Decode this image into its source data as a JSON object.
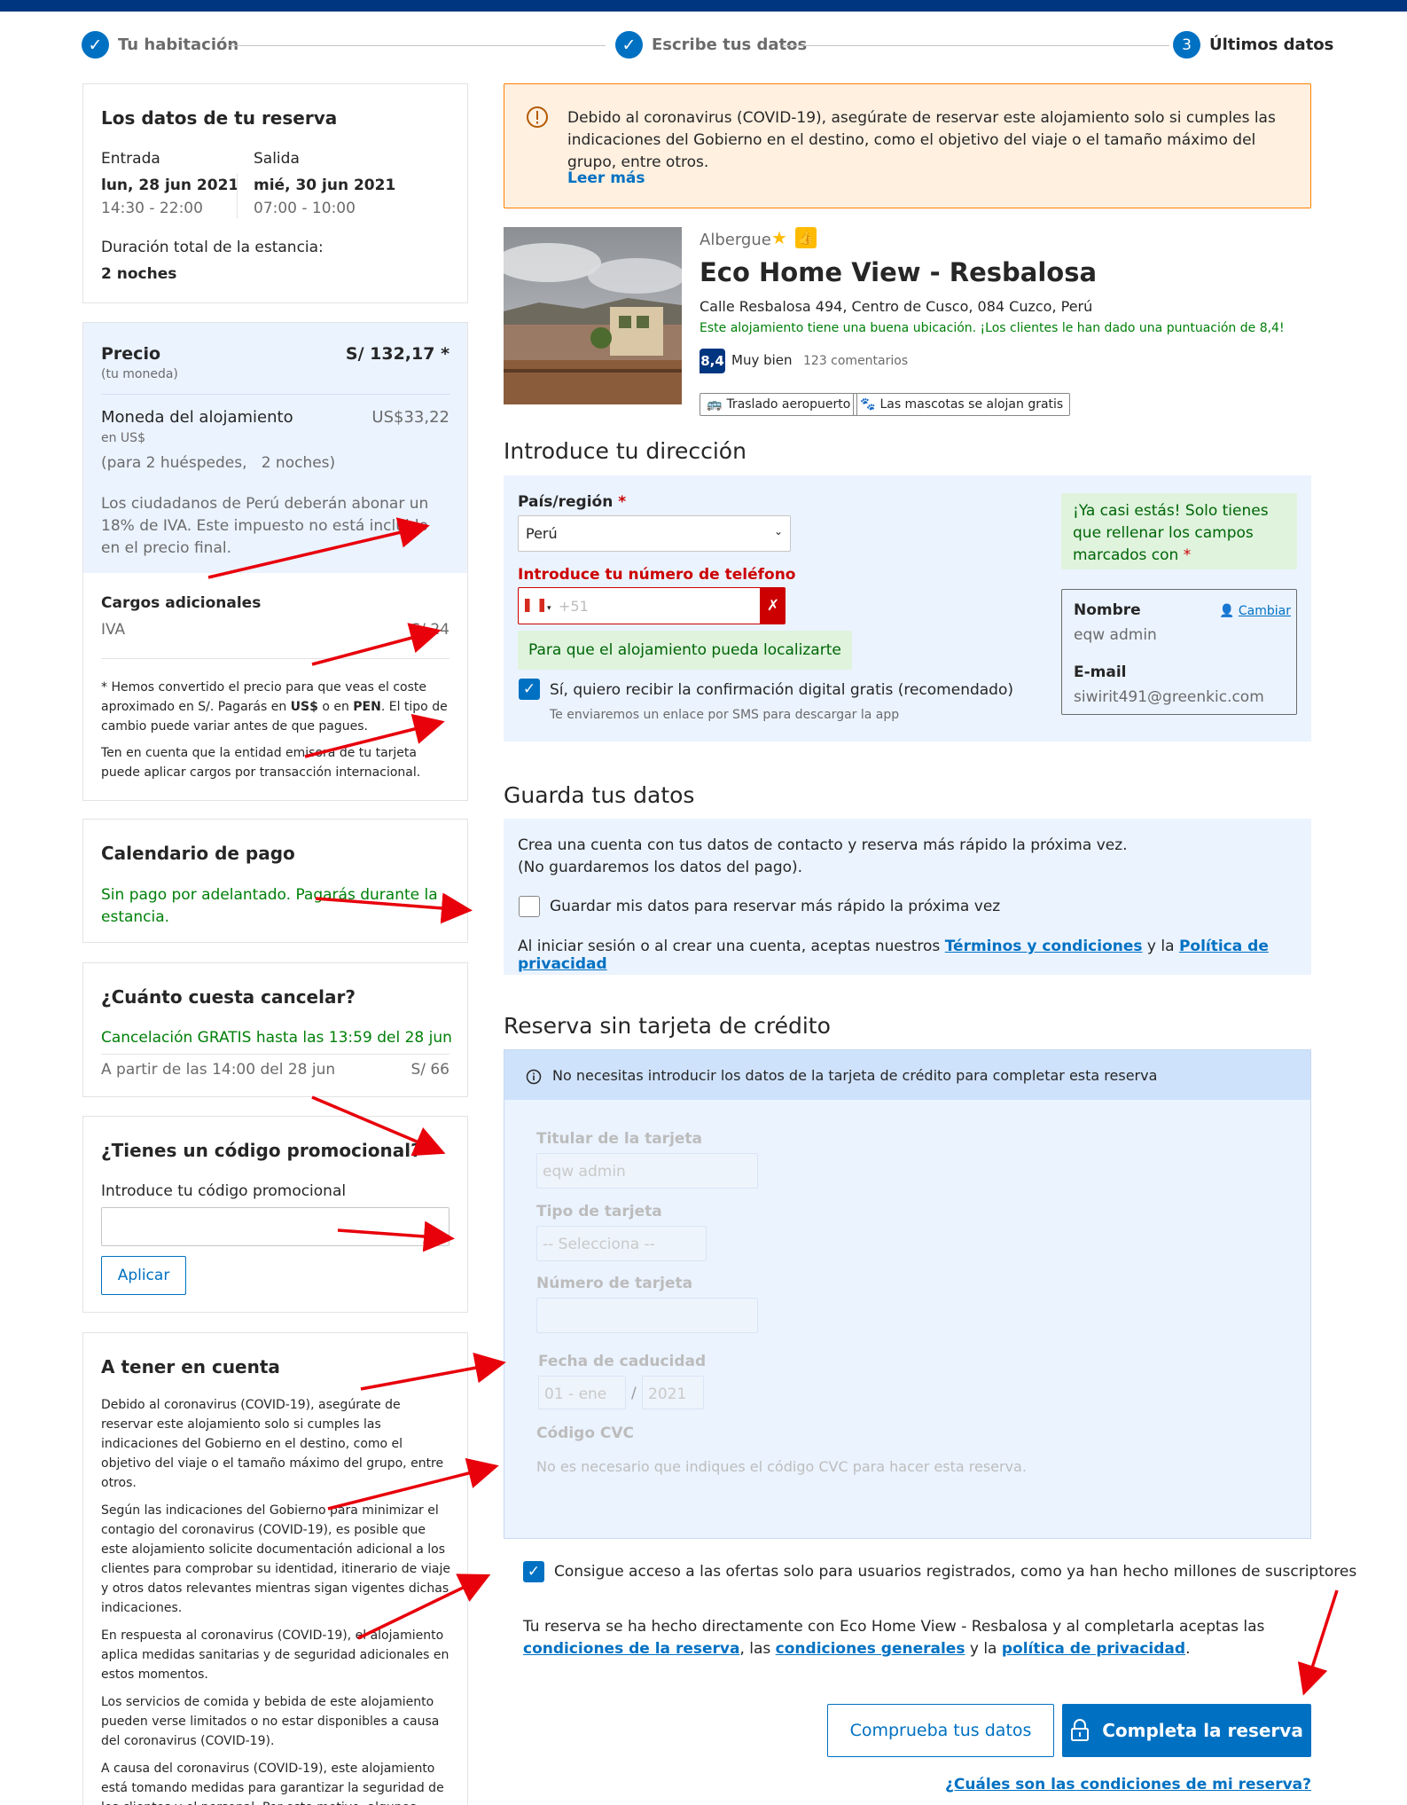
{
  "steps": [
    {
      "label": "Tu habitación",
      "done": true
    },
    {
      "label": "Escribe tus datos",
      "done": true
    },
    {
      "number": "3",
      "label": "Últimos datos",
      "done": false
    }
  ],
  "reservation": {
    "title": "Los datos de tu reserva",
    "checkin_label": "Entrada",
    "checkin_date": "lun, 28 jun 2021",
    "checkin_time": "14:30 - 22:00",
    "checkout_label": "Salida",
    "checkout_date": "mié, 30 jun 2021",
    "checkout_time": "07:00 - 10:00",
    "duration_label": "Duración total de la estancia:",
    "duration_value": "2 noches"
  },
  "price": {
    "label": "Precio",
    "value": "S/ 132,17 *",
    "currency_note": "(tu moneda)",
    "local_label": "Moneda del alojamiento",
    "local_value": "US$33,22",
    "local_sub": "en US$",
    "guests": "(para 2 huéspedes,   2 noches)",
    "tax_note": "Los ciudadanos de Perú deberán abonar un 18% de IVA. Este impuesto no está incluido en el precio final.",
    "extra_title": "Cargos adicionales",
    "extra_item": "IVA",
    "extra_value": "S/ 24",
    "conv_note_1": "* Hemos convertido el precio para que veas el coste aproximado en S/. Pagarás en ",
    "conv_usd": "US$",
    "conv_or": " o en ",
    "conv_pen": "PEN",
    "conv_note_2": ". El tipo de cambio puede variar antes de que pagues.",
    "card_note": "Ten en cuenta que la entidad emisora de tu tarjeta puede aplicar cargos por transacción internacional."
  },
  "payment_schedule": {
    "title": "Calendario de pago",
    "text": "Sin pago por adelantado. Pagarás durante la estancia."
  },
  "cancel": {
    "title": "¿Cuánto cuesta cancelar?",
    "free": "Cancelación GRATIS hasta las 13:59 del 28 jun",
    "after": "A partir de las 14:00 del 28 jun",
    "after_value": "S/ 66"
  },
  "promo": {
    "title": "¿Tienes un código promocional?",
    "label": "Introduce tu código promocional",
    "value": "",
    "button": "Aplicar"
  },
  "notes": {
    "title": "A tener en cuenta",
    "paragraphs": [
      "Debido al coronavirus (COVID-19), asegúrate de reservar este alojamiento solo si cumples las indicaciones del Gobierno en el destino, como el objetivo del viaje o el tamaño máximo del grupo, entre otros.",
      "Según las indicaciones del Gobierno para minimizar el contagio del coronavirus (COVID-19), es posible que este alojamiento solicite documentación adicional a los clientes para comprobar su identidad, itinerario de viaje y otros datos relevantes mientras sigan vigentes dichas indicaciones.",
      "En respuesta al coronavirus (COVID-19), el alojamiento aplica medidas sanitarias y de seguridad adicionales en estos momentos.",
      "Los servicios de comida y bebida de este alojamiento pueden verse limitados o no estar disponibles a causa del coronavirus (COVID-19).",
      "A causa del coronavirus (COVID-19), este alojamiento está tomando medidas para garantizar la seguridad de los clientes y el personal. Por este motivo, algunos servicios e"
    ]
  },
  "covid_banner": {
    "icon": "info-circle-icon",
    "text": "Debido al coronavirus (COVID-19), asegúrate de reservar este alojamiento solo si cumples las indicaciones del Gobierno en el destino, como el objetivo del viaje o el tamaño máximo del grupo, entre otros.",
    "link": "Leer más"
  },
  "hotel": {
    "type": "Albergue",
    "name": "Eco Home View - Resbalosa",
    "address": "Calle Resbalosa 494, Centro de Cusco, 084 Cuzco, Perú",
    "location_note": "Este alojamiento tiene una buena ubicación. ¡Los clientes le han dado una puntuación de 8,4!",
    "score": "8,4",
    "score_word": "Muy bien",
    "reviews": "123 comentarios",
    "facilities": [
      "Traslado aeropuerto",
      "Las mascotas se alojan gratis"
    ]
  },
  "address_form": {
    "title": "Introduce tu dirección",
    "country_label": "País/región",
    "required": "*",
    "country_value": "Perú",
    "phone_label": "Introduce tu número de teléfono",
    "phone_placeholder": "+51",
    "phone_hint": "Para que el alojamiento pueda localizarte",
    "sms_label": "Sí, quiero recibir la confirmación digital gratis (recomendado)",
    "sms_sub": "Te enviaremos un enlace por SMS para descargar la app",
    "almost_text": "¡Ya casi estás! Solo tienes que rellenar los campos marcados con",
    "name_label": "Nombre",
    "name_value": "eqw admin",
    "change_link": "Cambiar",
    "email_label": "E-mail",
    "email_value": "siwirit491@greenkic.com"
  },
  "save_data": {
    "title": "Guarda tus datos",
    "text1": "Crea una cuenta con tus datos de contacto y reserva más rápido la próxima vez.",
    "text2": "(No guardaremos los datos del pago).",
    "checkbox": "Guardar mis datos para reservar más rápido la próxima vez",
    "legal_pre": "Al iniciar sesión o al crear una cuenta, aceptas nuestros ",
    "terms": "Términos y condiciones",
    "and": " y la ",
    "privacy": "Política de privacidad"
  },
  "no_card": {
    "title": "Reserva sin tarjeta de crédito",
    "info": "No necesitas introducir los datos de la tarjeta de crédito para completar esta reserva",
    "holder_label": "Titular de la tarjeta",
    "holder_value": "eqw admin",
    "type_label": "Tipo de tarjeta",
    "type_value": "-- Selecciona --",
    "number_label": "Número de tarjeta",
    "expiry_label": "Fecha de caducidad",
    "expiry_month": "01 - ene",
    "expiry_sep": "/",
    "expiry_year": "2021",
    "cvc_label": "Código CVC",
    "cvc_note": "No es necesario que indiques el código CVC para hacer esta reserva."
  },
  "offers_checkbox": "Consigue acceso a las ofertas solo para usuarios registrados, como ya han hecho millones de suscriptores",
  "final_legal": {
    "pre": "Tu reserva se ha hecho directamente con Eco Home View - Resbalosa y al completarla aceptas las ",
    "conditions": "condiciones de la reserva",
    "mid": ", las ",
    "general": "condiciones generales",
    "and": " y la ",
    "privacy": "política de privacidad",
    "end": "."
  },
  "buttons": {
    "check": "Comprueba tus datos",
    "complete": "Completa la reserva",
    "faq": "¿Cuáles son las condiciones de mi reserva?"
  },
  "colors": {
    "brand": "#003580",
    "primary": "#0071c2",
    "green": "#008009",
    "error": "#cc0000",
    "annotation": "#e8000b"
  }
}
